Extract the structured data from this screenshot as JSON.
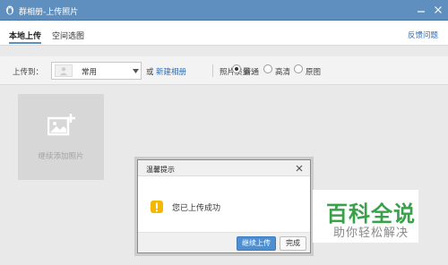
{
  "window": {
    "title": "群相册-上传照片"
  },
  "tabs": [
    {
      "label": "本地上传",
      "active": true
    },
    {
      "label": "空间选图",
      "active": false
    }
  ],
  "header": {
    "feedback_label": "反馈问题"
  },
  "options": {
    "upload_to_label": "上传到：",
    "album_selected": "常用",
    "or_label": "或",
    "new_album_label": "新建相册",
    "quality_label": "照片质量：",
    "quality_options": [
      {
        "label": "普通",
        "checked": true
      },
      {
        "label": "高清",
        "checked": false
      },
      {
        "label": "原图",
        "checked": false
      }
    ]
  },
  "add_tile": {
    "label": "继续添加照片"
  },
  "dialog": {
    "title": "温馨提示",
    "message": "您已上传成功",
    "continue_label": "继续上传",
    "done_label": "完成"
  },
  "watermark": {
    "brand": "百科全说",
    "tagline": "助你轻松解决"
  },
  "colors": {
    "titlebar": "#5e8fbf",
    "link": "#2b6bb3",
    "primary_button": "#4d8fd1",
    "watermark_green": "#37a24a",
    "warning": "#f5b800"
  }
}
